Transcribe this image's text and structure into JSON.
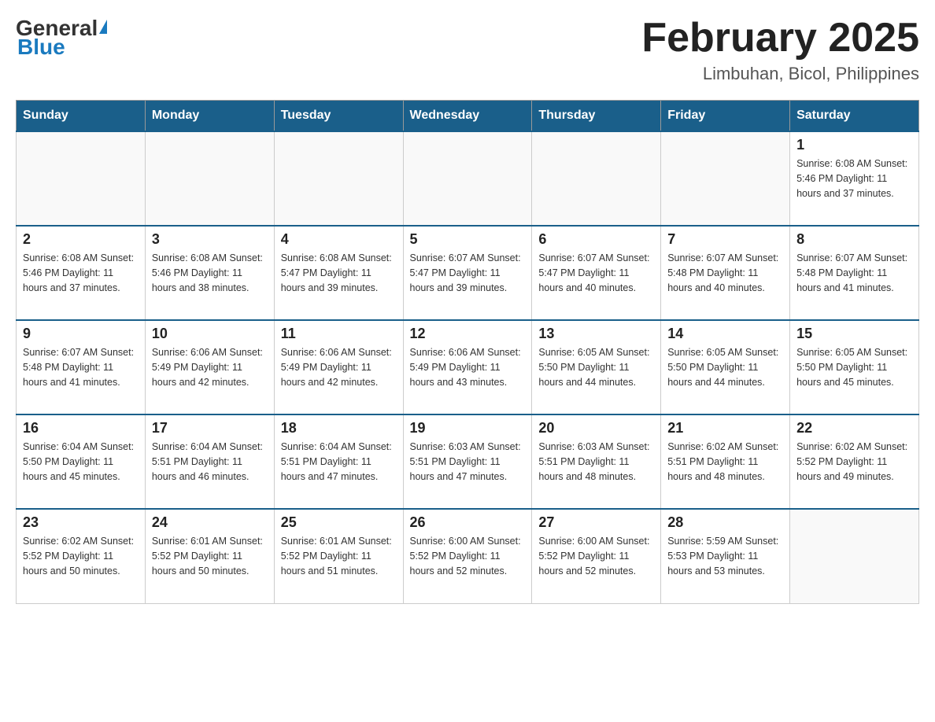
{
  "header": {
    "logo_general": "General",
    "logo_blue": "Blue",
    "month_title": "February 2025",
    "location": "Limbuhan, Bicol, Philippines"
  },
  "days_of_week": [
    "Sunday",
    "Monday",
    "Tuesday",
    "Wednesday",
    "Thursday",
    "Friday",
    "Saturday"
  ],
  "weeks": [
    [
      {
        "day": "",
        "info": ""
      },
      {
        "day": "",
        "info": ""
      },
      {
        "day": "",
        "info": ""
      },
      {
        "day": "",
        "info": ""
      },
      {
        "day": "",
        "info": ""
      },
      {
        "day": "",
        "info": ""
      },
      {
        "day": "1",
        "info": "Sunrise: 6:08 AM\nSunset: 5:46 PM\nDaylight: 11 hours and 37 minutes."
      }
    ],
    [
      {
        "day": "2",
        "info": "Sunrise: 6:08 AM\nSunset: 5:46 PM\nDaylight: 11 hours and 37 minutes."
      },
      {
        "day": "3",
        "info": "Sunrise: 6:08 AM\nSunset: 5:46 PM\nDaylight: 11 hours and 38 minutes."
      },
      {
        "day": "4",
        "info": "Sunrise: 6:08 AM\nSunset: 5:47 PM\nDaylight: 11 hours and 39 minutes."
      },
      {
        "day": "5",
        "info": "Sunrise: 6:07 AM\nSunset: 5:47 PM\nDaylight: 11 hours and 39 minutes."
      },
      {
        "day": "6",
        "info": "Sunrise: 6:07 AM\nSunset: 5:47 PM\nDaylight: 11 hours and 40 minutes."
      },
      {
        "day": "7",
        "info": "Sunrise: 6:07 AM\nSunset: 5:48 PM\nDaylight: 11 hours and 40 minutes."
      },
      {
        "day": "8",
        "info": "Sunrise: 6:07 AM\nSunset: 5:48 PM\nDaylight: 11 hours and 41 minutes."
      }
    ],
    [
      {
        "day": "9",
        "info": "Sunrise: 6:07 AM\nSunset: 5:48 PM\nDaylight: 11 hours and 41 minutes."
      },
      {
        "day": "10",
        "info": "Sunrise: 6:06 AM\nSunset: 5:49 PM\nDaylight: 11 hours and 42 minutes."
      },
      {
        "day": "11",
        "info": "Sunrise: 6:06 AM\nSunset: 5:49 PM\nDaylight: 11 hours and 42 minutes."
      },
      {
        "day": "12",
        "info": "Sunrise: 6:06 AM\nSunset: 5:49 PM\nDaylight: 11 hours and 43 minutes."
      },
      {
        "day": "13",
        "info": "Sunrise: 6:05 AM\nSunset: 5:50 PM\nDaylight: 11 hours and 44 minutes."
      },
      {
        "day": "14",
        "info": "Sunrise: 6:05 AM\nSunset: 5:50 PM\nDaylight: 11 hours and 44 minutes."
      },
      {
        "day": "15",
        "info": "Sunrise: 6:05 AM\nSunset: 5:50 PM\nDaylight: 11 hours and 45 minutes."
      }
    ],
    [
      {
        "day": "16",
        "info": "Sunrise: 6:04 AM\nSunset: 5:50 PM\nDaylight: 11 hours and 45 minutes."
      },
      {
        "day": "17",
        "info": "Sunrise: 6:04 AM\nSunset: 5:51 PM\nDaylight: 11 hours and 46 minutes."
      },
      {
        "day": "18",
        "info": "Sunrise: 6:04 AM\nSunset: 5:51 PM\nDaylight: 11 hours and 47 minutes."
      },
      {
        "day": "19",
        "info": "Sunrise: 6:03 AM\nSunset: 5:51 PM\nDaylight: 11 hours and 47 minutes."
      },
      {
        "day": "20",
        "info": "Sunrise: 6:03 AM\nSunset: 5:51 PM\nDaylight: 11 hours and 48 minutes."
      },
      {
        "day": "21",
        "info": "Sunrise: 6:02 AM\nSunset: 5:51 PM\nDaylight: 11 hours and 48 minutes."
      },
      {
        "day": "22",
        "info": "Sunrise: 6:02 AM\nSunset: 5:52 PM\nDaylight: 11 hours and 49 minutes."
      }
    ],
    [
      {
        "day": "23",
        "info": "Sunrise: 6:02 AM\nSunset: 5:52 PM\nDaylight: 11 hours and 50 minutes."
      },
      {
        "day": "24",
        "info": "Sunrise: 6:01 AM\nSunset: 5:52 PM\nDaylight: 11 hours and 50 minutes."
      },
      {
        "day": "25",
        "info": "Sunrise: 6:01 AM\nSunset: 5:52 PM\nDaylight: 11 hours and 51 minutes."
      },
      {
        "day": "26",
        "info": "Sunrise: 6:00 AM\nSunset: 5:52 PM\nDaylight: 11 hours and 52 minutes."
      },
      {
        "day": "27",
        "info": "Sunrise: 6:00 AM\nSunset: 5:52 PM\nDaylight: 11 hours and 52 minutes."
      },
      {
        "day": "28",
        "info": "Sunrise: 5:59 AM\nSunset: 5:53 PM\nDaylight: 11 hours and 53 minutes."
      },
      {
        "day": "",
        "info": ""
      }
    ]
  ]
}
